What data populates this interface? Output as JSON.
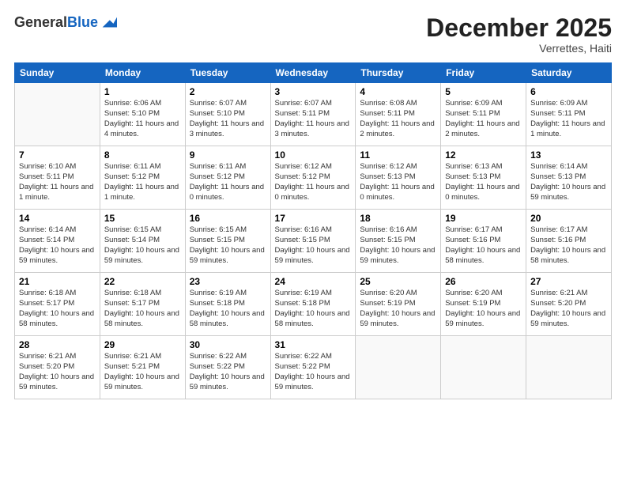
{
  "logo": {
    "general": "General",
    "blue": "Blue"
  },
  "title": "December 2025",
  "location": "Verrettes, Haiti",
  "days_header": [
    "Sunday",
    "Monday",
    "Tuesday",
    "Wednesday",
    "Thursday",
    "Friday",
    "Saturday"
  ],
  "weeks": [
    [
      {
        "day": "",
        "sunrise": "",
        "sunset": "",
        "daylight": ""
      },
      {
        "day": "1",
        "sunrise": "Sunrise: 6:06 AM",
        "sunset": "Sunset: 5:10 PM",
        "daylight": "Daylight: 11 hours and 4 minutes."
      },
      {
        "day": "2",
        "sunrise": "Sunrise: 6:07 AM",
        "sunset": "Sunset: 5:10 PM",
        "daylight": "Daylight: 11 hours and 3 minutes."
      },
      {
        "day": "3",
        "sunrise": "Sunrise: 6:07 AM",
        "sunset": "Sunset: 5:11 PM",
        "daylight": "Daylight: 11 hours and 3 minutes."
      },
      {
        "day": "4",
        "sunrise": "Sunrise: 6:08 AM",
        "sunset": "Sunset: 5:11 PM",
        "daylight": "Daylight: 11 hours and 2 minutes."
      },
      {
        "day": "5",
        "sunrise": "Sunrise: 6:09 AM",
        "sunset": "Sunset: 5:11 PM",
        "daylight": "Daylight: 11 hours and 2 minutes."
      },
      {
        "day": "6",
        "sunrise": "Sunrise: 6:09 AM",
        "sunset": "Sunset: 5:11 PM",
        "daylight": "Daylight: 11 hours and 1 minute."
      }
    ],
    [
      {
        "day": "7",
        "sunrise": "Sunrise: 6:10 AM",
        "sunset": "Sunset: 5:11 PM",
        "daylight": "Daylight: 11 hours and 1 minute."
      },
      {
        "day": "8",
        "sunrise": "Sunrise: 6:11 AM",
        "sunset": "Sunset: 5:12 PM",
        "daylight": "Daylight: 11 hours and 1 minute."
      },
      {
        "day": "9",
        "sunrise": "Sunrise: 6:11 AM",
        "sunset": "Sunset: 5:12 PM",
        "daylight": "Daylight: 11 hours and 0 minutes."
      },
      {
        "day": "10",
        "sunrise": "Sunrise: 6:12 AM",
        "sunset": "Sunset: 5:12 PM",
        "daylight": "Daylight: 11 hours and 0 minutes."
      },
      {
        "day": "11",
        "sunrise": "Sunrise: 6:12 AM",
        "sunset": "Sunset: 5:13 PM",
        "daylight": "Daylight: 11 hours and 0 minutes."
      },
      {
        "day": "12",
        "sunrise": "Sunrise: 6:13 AM",
        "sunset": "Sunset: 5:13 PM",
        "daylight": "Daylight: 11 hours and 0 minutes."
      },
      {
        "day": "13",
        "sunrise": "Sunrise: 6:14 AM",
        "sunset": "Sunset: 5:13 PM",
        "daylight": "Daylight: 10 hours and 59 minutes."
      }
    ],
    [
      {
        "day": "14",
        "sunrise": "Sunrise: 6:14 AM",
        "sunset": "Sunset: 5:14 PM",
        "daylight": "Daylight: 10 hours and 59 minutes."
      },
      {
        "day": "15",
        "sunrise": "Sunrise: 6:15 AM",
        "sunset": "Sunset: 5:14 PM",
        "daylight": "Daylight: 10 hours and 59 minutes."
      },
      {
        "day": "16",
        "sunrise": "Sunrise: 6:15 AM",
        "sunset": "Sunset: 5:15 PM",
        "daylight": "Daylight: 10 hours and 59 minutes."
      },
      {
        "day": "17",
        "sunrise": "Sunrise: 6:16 AM",
        "sunset": "Sunset: 5:15 PM",
        "daylight": "Daylight: 10 hours and 59 minutes."
      },
      {
        "day": "18",
        "sunrise": "Sunrise: 6:16 AM",
        "sunset": "Sunset: 5:15 PM",
        "daylight": "Daylight: 10 hours and 59 minutes."
      },
      {
        "day": "19",
        "sunrise": "Sunrise: 6:17 AM",
        "sunset": "Sunset: 5:16 PM",
        "daylight": "Daylight: 10 hours and 58 minutes."
      },
      {
        "day": "20",
        "sunrise": "Sunrise: 6:17 AM",
        "sunset": "Sunset: 5:16 PM",
        "daylight": "Daylight: 10 hours and 58 minutes."
      }
    ],
    [
      {
        "day": "21",
        "sunrise": "Sunrise: 6:18 AM",
        "sunset": "Sunset: 5:17 PM",
        "daylight": "Daylight: 10 hours and 58 minutes."
      },
      {
        "day": "22",
        "sunrise": "Sunrise: 6:18 AM",
        "sunset": "Sunset: 5:17 PM",
        "daylight": "Daylight: 10 hours and 58 minutes."
      },
      {
        "day": "23",
        "sunrise": "Sunrise: 6:19 AM",
        "sunset": "Sunset: 5:18 PM",
        "daylight": "Daylight: 10 hours and 58 minutes."
      },
      {
        "day": "24",
        "sunrise": "Sunrise: 6:19 AM",
        "sunset": "Sunset: 5:18 PM",
        "daylight": "Daylight: 10 hours and 58 minutes."
      },
      {
        "day": "25",
        "sunrise": "Sunrise: 6:20 AM",
        "sunset": "Sunset: 5:19 PM",
        "daylight": "Daylight: 10 hours and 59 minutes."
      },
      {
        "day": "26",
        "sunrise": "Sunrise: 6:20 AM",
        "sunset": "Sunset: 5:19 PM",
        "daylight": "Daylight: 10 hours and 59 minutes."
      },
      {
        "day": "27",
        "sunrise": "Sunrise: 6:21 AM",
        "sunset": "Sunset: 5:20 PM",
        "daylight": "Daylight: 10 hours and 59 minutes."
      }
    ],
    [
      {
        "day": "28",
        "sunrise": "Sunrise: 6:21 AM",
        "sunset": "Sunset: 5:20 PM",
        "daylight": "Daylight: 10 hours and 59 minutes."
      },
      {
        "day": "29",
        "sunrise": "Sunrise: 6:21 AM",
        "sunset": "Sunset: 5:21 PM",
        "daylight": "Daylight: 10 hours and 59 minutes."
      },
      {
        "day": "30",
        "sunrise": "Sunrise: 6:22 AM",
        "sunset": "Sunset: 5:22 PM",
        "daylight": "Daylight: 10 hours and 59 minutes."
      },
      {
        "day": "31",
        "sunrise": "Sunrise: 6:22 AM",
        "sunset": "Sunset: 5:22 PM",
        "daylight": "Daylight: 10 hours and 59 minutes."
      },
      {
        "day": "",
        "sunrise": "",
        "sunset": "",
        "daylight": ""
      },
      {
        "day": "",
        "sunrise": "",
        "sunset": "",
        "daylight": ""
      },
      {
        "day": "",
        "sunrise": "",
        "sunset": "",
        "daylight": ""
      }
    ]
  ]
}
